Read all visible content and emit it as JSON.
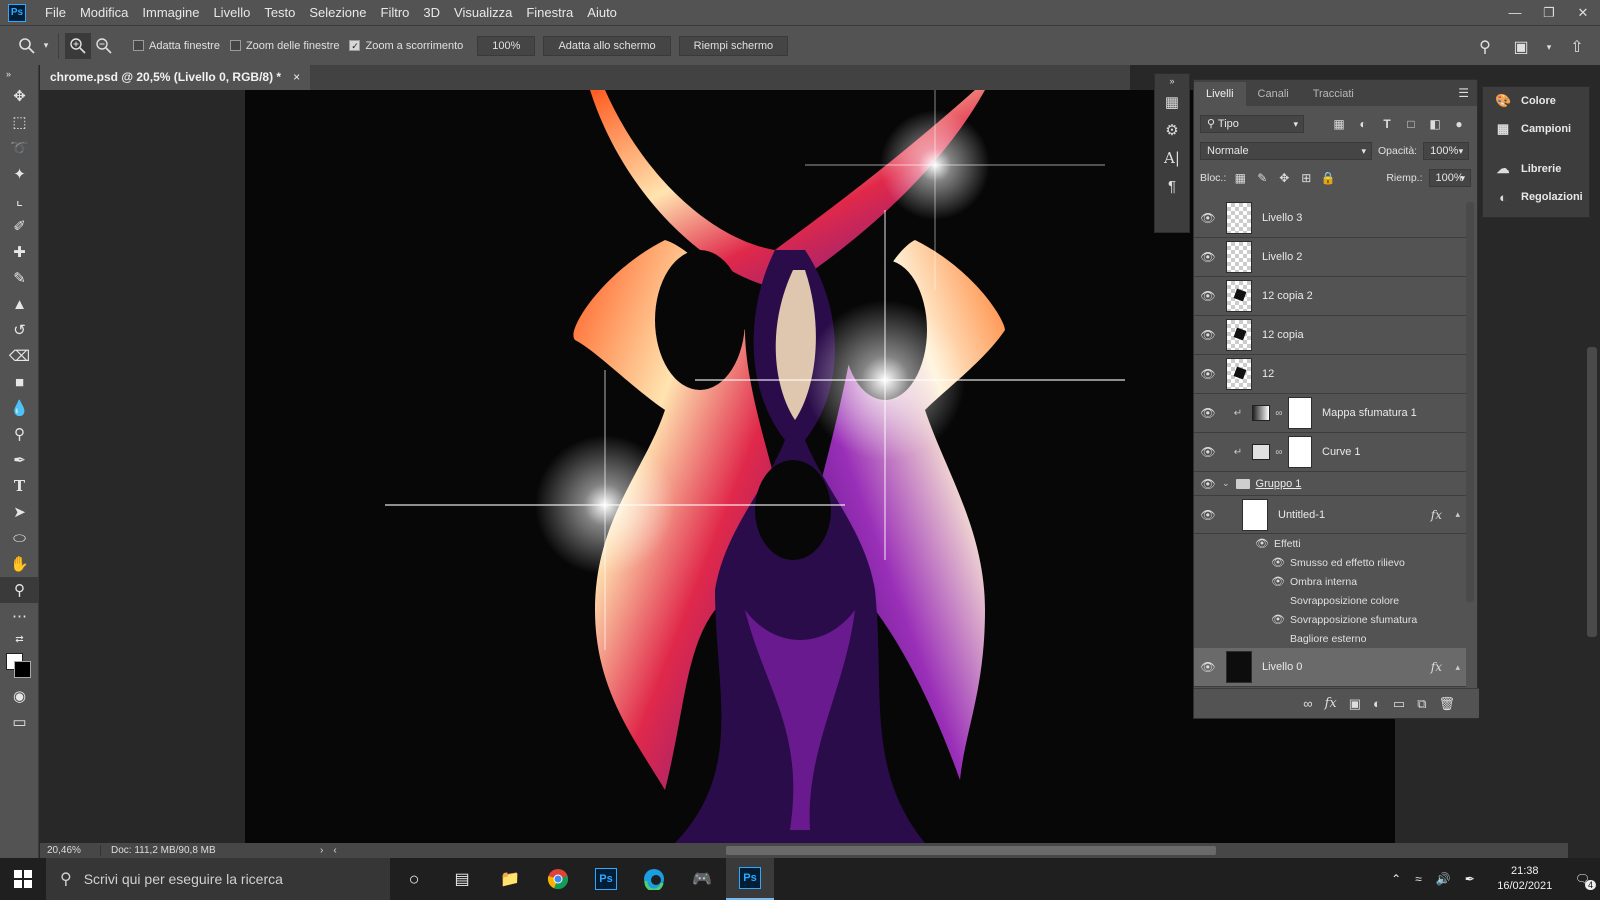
{
  "app": {
    "logo": "Ps"
  },
  "menu": [
    "File",
    "Modifica",
    "Immagine",
    "Livello",
    "Testo",
    "Selezione",
    "Filtro",
    "3D",
    "Visualizza",
    "Finestra",
    "Aiuto"
  ],
  "options": {
    "adatta_finestre": "Adatta finestre",
    "zoom_finestre": "Zoom delle finestre",
    "zoom_scorrimento": "Zoom a scorrimento",
    "zoom_value": "100%",
    "adatta_schermo": "Adatta allo schermo",
    "riempi_schermo": "Riempi schermo"
  },
  "document": {
    "tab_title": "chrome.psd @ 20,5% (Livello 0, RGB/8) *",
    "close": "×"
  },
  "status": {
    "zoom": "20,46%",
    "doc": "Doc: 111,2 MB/90,8 MB"
  },
  "layers_panel": {
    "tabs": [
      "Livelli",
      "Canali",
      "Tracciati"
    ],
    "filter": "Tipo",
    "blend_mode": "Normale",
    "opacity_label": "Opacità:",
    "opacity_value": "100%",
    "lock_label": "Bloc.:",
    "fill_label": "Riemp.:",
    "fill_value": "100%",
    "layers": [
      {
        "name": "Livello 3"
      },
      {
        "name": "Livello 2"
      },
      {
        "name": "12 copia 2"
      },
      {
        "name": "12 copia"
      },
      {
        "name": "12"
      },
      {
        "name": "Mappa sfumatura 1"
      },
      {
        "name": "Curve 1"
      }
    ],
    "group": "Gruppo 1",
    "untitled": "Untitled-1",
    "effects_label": "Effetti",
    "effects": [
      "Smusso ed effetto rilievo",
      "Ombra interna",
      "Sovrapposizione colore",
      "Sovrapposizione sfumatura",
      "Bagliore esterno"
    ],
    "bottom_layer": "Livello 0",
    "fx": "fx"
  },
  "side_panel": [
    "Colore",
    "Campioni",
    "Librerie",
    "Regolazioni"
  ],
  "taskbar": {
    "search_placeholder": "Scrivi qui per eseguire la ricerca",
    "time": "21:38",
    "date": "16/02/2021",
    "notifications": "4"
  },
  "colors": {
    "accent": "#31a8ff",
    "panel": "#535353",
    "canvas": "#070707"
  }
}
